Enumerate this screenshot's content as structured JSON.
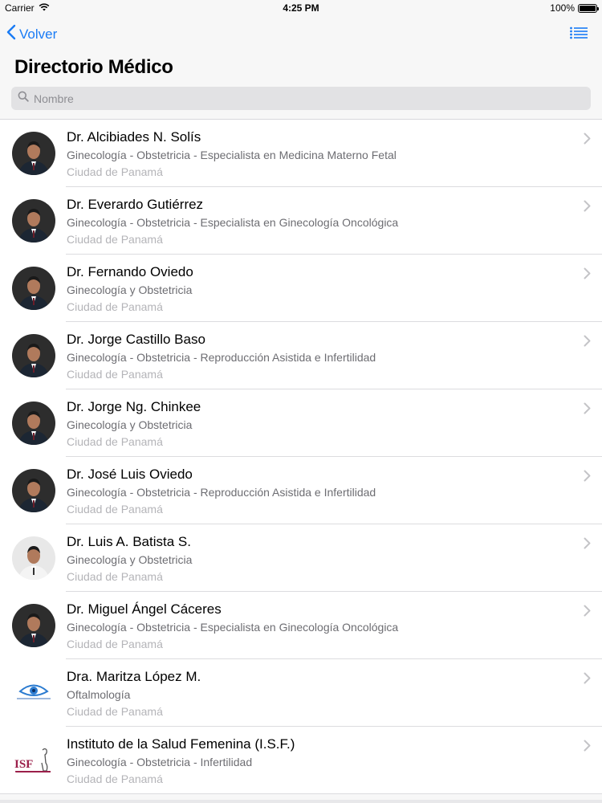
{
  "status_bar": {
    "carrier": "Carrier",
    "time": "4:25 PM",
    "battery": "100%",
    "battery_level": 1.0
  },
  "nav": {
    "back_label": "Volver",
    "back_icon": "chevron-left-icon",
    "menu_icon": "list-icon",
    "accent_color": "#1a7cf5"
  },
  "page": {
    "title": "Directorio Médico"
  },
  "search": {
    "placeholder": "Nombre",
    "value": ""
  },
  "doctors": [
    {
      "name": "Dr. Alcibiades N. Solís",
      "specialty": "Ginecología - Obstetricia - Especialista en Medicina Materno Fetal",
      "location": "Ciudad de Panamá",
      "avatar": "photo"
    },
    {
      "name": "Dr. Everardo Gutiérrez",
      "specialty": "Ginecología - Obstetricia - Especialista en Ginecología Oncológica",
      "location": "Ciudad de Panamá",
      "avatar": "photo"
    },
    {
      "name": "Dr. Fernando Oviedo",
      "specialty": "Ginecología y Obstetricia",
      "location": "Ciudad de Panamá",
      "avatar": "photo"
    },
    {
      "name": "Dr. Jorge Castillo Baso",
      "specialty": "Ginecología - Obstetricia - Reproducción Asistida e Infertilidad",
      "location": "Ciudad de Panamá",
      "avatar": "photo"
    },
    {
      "name": "Dr. Jorge Ng. Chinkee",
      "specialty": "Ginecología y Obstetricia",
      "location": "Ciudad de Panamá",
      "avatar": "photo"
    },
    {
      "name": "Dr. José Luis Oviedo",
      "specialty": "Ginecología - Obstetricia - Reproducción Asistida e Infertilidad",
      "location": "Ciudad de Panamá",
      "avatar": "photo"
    },
    {
      "name": "Dr. Luis A. Batista S.",
      "specialty": "Ginecología y Obstetricia",
      "location": "Ciudad de Panamá",
      "avatar": "photo-light"
    },
    {
      "name": "Dr. Miguel Ángel Cáceres",
      "specialty": "Ginecología - Obstetricia - Especialista en Ginecología Oncológica",
      "location": "Ciudad de Panamá",
      "avatar": "photo"
    },
    {
      "name": "Dra. Maritza López M.",
      "specialty": "Oftalmología",
      "location": "Ciudad de Panamá",
      "avatar": "eye-logo"
    },
    {
      "name": "Instituto de la Salud Femenina (I.S.F.)",
      "specialty": "Ginecología - Obstetricia - Infertilidad",
      "location": "Ciudad de Panamá",
      "avatar": "isf-logo",
      "logo_text": "ISF"
    }
  ]
}
